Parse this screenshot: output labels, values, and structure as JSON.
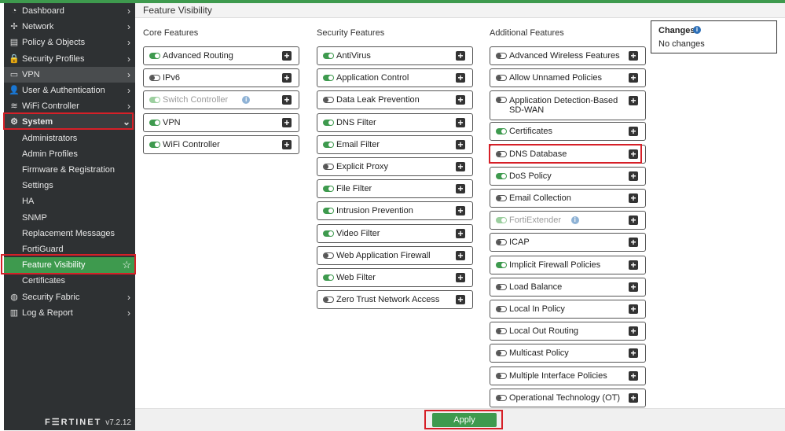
{
  "sidebar": {
    "items": [
      {
        "label": "Dashboard",
        "icon": "dashboard-icon",
        "glyph": "◔"
      },
      {
        "label": "Network",
        "icon": "network-icon",
        "glyph": "✢"
      },
      {
        "label": "Policy & Objects",
        "icon": "policy-icon",
        "glyph": "▤"
      },
      {
        "label": "Security Profiles",
        "icon": "lock-icon",
        "glyph": "🔒"
      },
      {
        "label": "VPN",
        "icon": "monitor-icon",
        "glyph": "▭"
      },
      {
        "label": "User & Authentication",
        "icon": "user-icon",
        "glyph": "👤"
      },
      {
        "label": "WiFi Controller",
        "icon": "wifi-icon",
        "glyph": "≋"
      },
      {
        "label": "System",
        "icon": "gear-icon",
        "glyph": "⚙"
      }
    ],
    "system_subitems": [
      "Administrators",
      "Admin Profiles",
      "Firmware & Registration",
      "Settings",
      "HA",
      "SNMP",
      "Replacement Messages",
      "FortiGuard",
      "Feature Visibility",
      "Certificates"
    ],
    "bottom_items": [
      {
        "label": "Security Fabric",
        "icon": "fabric-icon",
        "glyph": "◍"
      },
      {
        "label": "Log & Report",
        "icon": "chart-icon",
        "glyph": "▥"
      }
    ],
    "brand": "F☰RTINET",
    "version": "v7.2.12"
  },
  "page": {
    "title": "Feature Visibility"
  },
  "columns": {
    "core": {
      "title": "Core Features",
      "items": [
        {
          "name": "Advanced Routing",
          "on": true
        },
        {
          "name": "IPv6",
          "on": false
        },
        {
          "name": "Switch Controller",
          "on": true,
          "disabled": true,
          "info": true
        },
        {
          "name": "VPN",
          "on": true
        },
        {
          "name": "WiFi Controller",
          "on": true
        }
      ]
    },
    "security": {
      "title": "Security Features",
      "items": [
        {
          "name": "AntiVirus",
          "on": true
        },
        {
          "name": "Application Control",
          "on": true
        },
        {
          "name": "Data Leak Prevention",
          "on": false
        },
        {
          "name": "DNS Filter",
          "on": true
        },
        {
          "name": "Email Filter",
          "on": true
        },
        {
          "name": "Explicit Proxy",
          "on": false
        },
        {
          "name": "File Filter",
          "on": true
        },
        {
          "name": "Intrusion Prevention",
          "on": true
        },
        {
          "name": "Video Filter",
          "on": true
        },
        {
          "name": "Web Application Firewall",
          "on": false
        },
        {
          "name": "Web Filter",
          "on": true
        },
        {
          "name": "Zero Trust Network Access",
          "on": false
        }
      ]
    },
    "additional": {
      "title": "Additional Features",
      "items": [
        {
          "name": "Advanced Wireless Features",
          "on": false
        },
        {
          "name": "Allow Unnamed Policies",
          "on": false
        },
        {
          "name": "Application Detection-Based SD-WAN",
          "on": false,
          "tall": true
        },
        {
          "name": "Certificates",
          "on": true
        },
        {
          "name": "DNS Database",
          "on": false
        },
        {
          "name": "DoS Policy",
          "on": true
        },
        {
          "name": "Email Collection",
          "on": false
        },
        {
          "name": "FortiExtender",
          "on": true,
          "disabled": true,
          "info": true
        },
        {
          "name": "ICAP",
          "on": false
        },
        {
          "name": "Implicit Firewall Policies",
          "on": true
        },
        {
          "name": "Load Balance",
          "on": false
        },
        {
          "name": "Local In Policy",
          "on": false
        },
        {
          "name": "Local Out Routing",
          "on": false
        },
        {
          "name": "Multicast Policy",
          "on": false
        },
        {
          "name": "Multiple Interface Policies",
          "on": false
        },
        {
          "name": "Operational Technology (OT)",
          "on": false
        }
      ]
    }
  },
  "changes": {
    "title": "Changes",
    "text": "No changes"
  },
  "apply_label": "Apply",
  "colors": {
    "accent": "#3e9a4e",
    "sidebar": "#2e3133",
    "highlight": "#d62028"
  }
}
